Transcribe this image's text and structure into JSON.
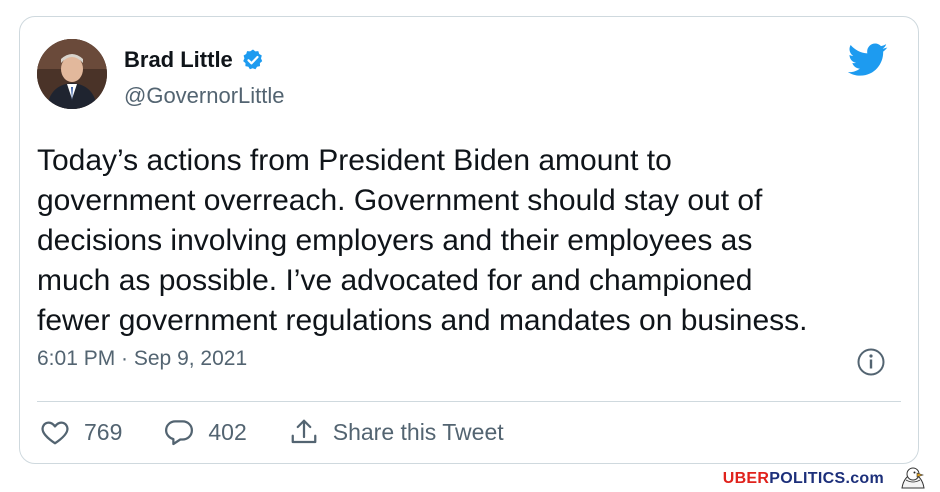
{
  "tweet": {
    "author_name": "Brad Little",
    "author_handle": "@GovernorLittle",
    "text": "Today’s actions from President Biden amount to\ngovernment overreach. Government should stay out of\ndecisions involving employers and their employees as\nmuch as possible. I’ve advocated for and championed\nfewer government regulations and mandates on business.",
    "timestamp": "6:01 PM · Sep 9, 2021",
    "likes": "769",
    "replies": "402",
    "share_label": "Share this Tweet"
  },
  "colors": {
    "twitter_blue": "#1d9bf0",
    "text_primary": "#0f1419",
    "text_secondary": "#536471",
    "border": "#cfd9de"
  },
  "icons": [
    "verified-badge-icon",
    "twitter-bird-icon",
    "info-icon",
    "heart-icon",
    "reply-bubble-icon",
    "share-icon",
    "eagle-logo-icon"
  ],
  "watermark": {
    "part1": "UBER",
    "part2": "POLITICS",
    "part3": ".com"
  }
}
